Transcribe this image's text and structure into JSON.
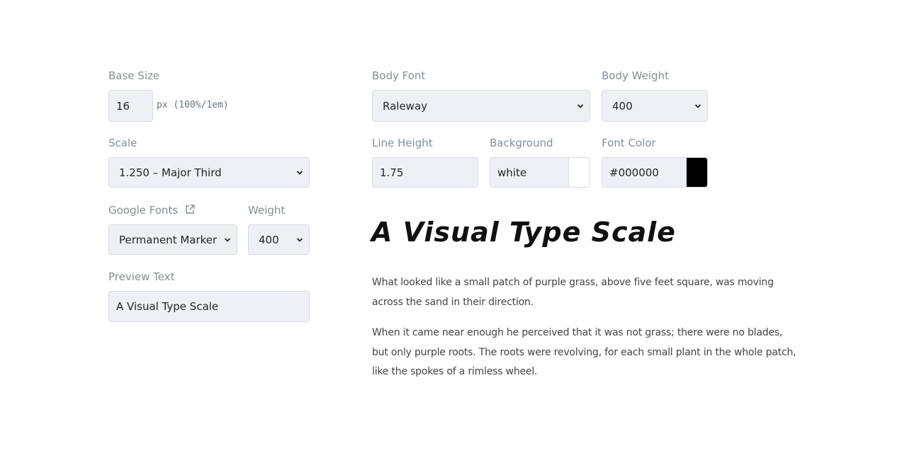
{
  "base_size": {
    "label": "Base Size",
    "value": "16",
    "unit": "px (100%/1em)"
  },
  "scale": {
    "label": "Scale",
    "selected": "1.250 – Major Third"
  },
  "google_fonts": {
    "label": "Google Fonts",
    "selected": "Permanent Marker",
    "icon": "external-link-icon"
  },
  "heading_weight": {
    "label": "Weight",
    "selected": "400"
  },
  "preview_text": {
    "label": "Preview Text",
    "value": "A Visual Type Scale"
  },
  "body_font": {
    "label": "Body Font",
    "selected": "Raleway"
  },
  "body_weight": {
    "label": "Body Weight",
    "selected": "400"
  },
  "line_height": {
    "label": "Line Height",
    "value": "1.75"
  },
  "background": {
    "label": "Background",
    "value": "white",
    "swatch_color": "#ffffff"
  },
  "font_color": {
    "label": "Font Color",
    "value": "#000000",
    "swatch_color": "#000000"
  },
  "preview": {
    "title": "A Visual Type Scale",
    "paragraphs": [
      "What looked like a small patch of purple grass, above five feet square, was moving across the sand in their direction.",
      "When it came near enough he perceived that it was not grass; there were no blades, but only purple roots. The roots were revolving, for each small plant in the whole patch, like the spokes of a rimless wheel."
    ]
  }
}
